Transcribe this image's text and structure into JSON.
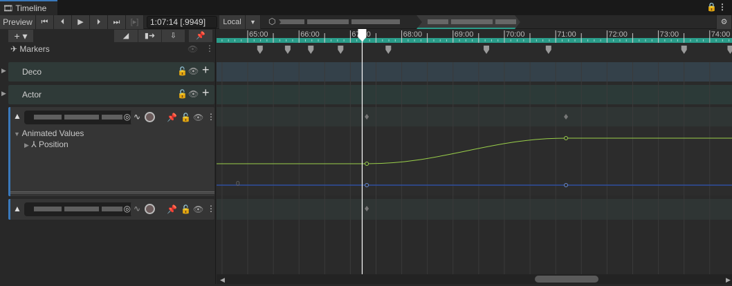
{
  "window": {
    "title": "Timeline",
    "lock_icon": "lock-icon",
    "menu_icon": "kebab-icon"
  },
  "toolbar": {
    "preview_label": "Preview",
    "time": "1:07:14 [.9949]",
    "space_label": "Local",
    "settings_icon": "gear-icon"
  },
  "left_header": {
    "add_label": "+"
  },
  "tracks": {
    "markers": {
      "label": "Markers"
    },
    "deco": {
      "label": "Deco"
    },
    "actor": {
      "label": "Actor"
    },
    "anim": {
      "animated_values": "Animated Values",
      "position": "Position",
      "zero_label": "0"
    }
  },
  "ruler": {
    "ticks": [
      "65:00",
      "66:00",
      "67:00",
      "68:00",
      "69:00",
      "70:00",
      "71:00",
      "72:00",
      "73:00",
      "74:00"
    ],
    "playhead_minutes": 67.23
  },
  "markers_minutes": [
    65.24,
    65.78,
    66.23,
    66.81,
    67.74,
    69.65,
    70.86,
    73.5,
    74.4
  ],
  "curves": {
    "green_color": "#9bd14a",
    "blue_color": "#2f4fa0",
    "keys_minutes": [
      67.32,
      71.2
    ]
  },
  "colors": {
    "accent_teal": "#2a9d8a",
    "track_blue": "#3a79bb"
  }
}
